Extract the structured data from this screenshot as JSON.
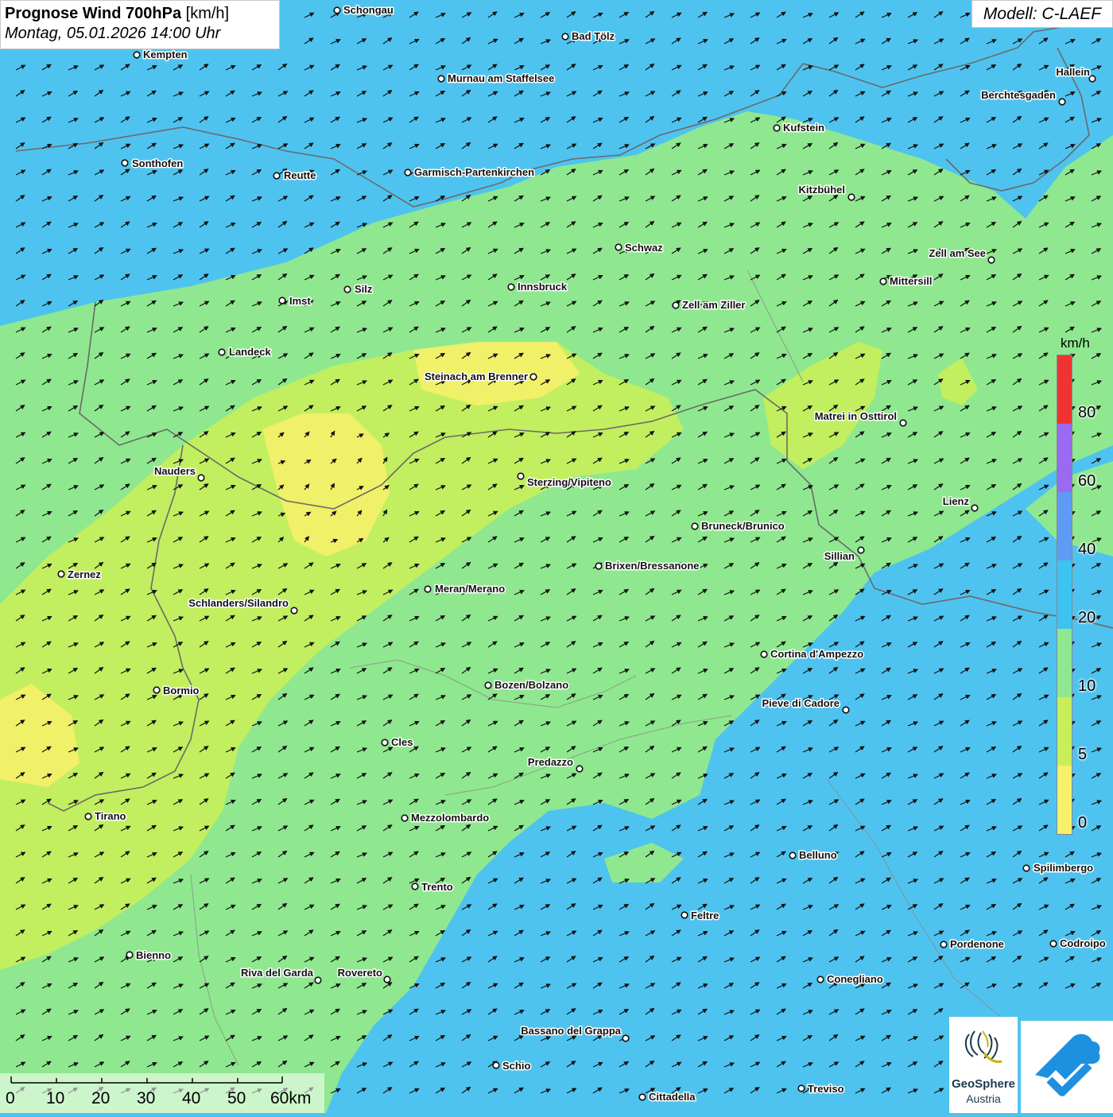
{
  "title": {
    "main": "Prognose Wind 700hPa",
    "unit": "[km/h]",
    "datetime": "Montag, 05.01.2026 14:00 Uhr"
  },
  "model": "Modell: C-LAEF",
  "legend": {
    "unit": "km/h",
    "ticks": [
      "80",
      "60",
      "40",
      "20",
      "10",
      "5",
      "0"
    ],
    "colors": {
      "over80": "#f03232",
      "60_80": "#9a6af0",
      "40_60": "#5f9bf5",
      "20_40": "#3cc3f0",
      "10_20": "#8fe88f",
      "5_10": "#c8ef5a",
      "0_5": "#f6f06a"
    }
  },
  "scale": {
    "labels": [
      "0",
      "10",
      "20",
      "30",
      "40",
      "50",
      "60km"
    ]
  },
  "logos": {
    "geosphere_line1": "GeoSphere",
    "geosphere_line2": "Austria"
  },
  "cities": [
    "Schongau",
    "Bad Tölz",
    "Kempten",
    "Murnau am Staffelsee",
    "Hallein",
    "Berchtesgaden",
    "Kufstein",
    "Sonthofen",
    "Reutte",
    "Garmisch-Partenkirchen",
    "Kitzbühel",
    "Schwaz",
    "Zell am See",
    "Mittersill",
    "Innsbruck",
    "Silz",
    "Imst",
    "Zell am Ziller",
    "Landeck",
    "Steinach am Brenner",
    "Matrei in Osttirol",
    "Nauders",
    "Sterzing/Vipiteno",
    "Lienz",
    "Bruneck/Brunico",
    "Sillian",
    "Zernez",
    "Brixen/Bressanone",
    "Meran/Merano",
    "Schlanders/Silandro",
    "Cortina d'Ampezzo",
    "Bozen/Bolzano",
    "Bormio",
    "Pieve di Cadore",
    "Cles",
    "Predazzo",
    "Tirano",
    "Mezzolombardo",
    "Belluno",
    "Spilimbergo",
    "Trento",
    "Feltre",
    "Pordenone",
    "Codroipo",
    "Bienno",
    "Riva del Garda",
    "Rovereto",
    "Conegliano",
    "Bassano del Grappa",
    "Schio",
    "Treviso",
    "Cittadella"
  ]
}
